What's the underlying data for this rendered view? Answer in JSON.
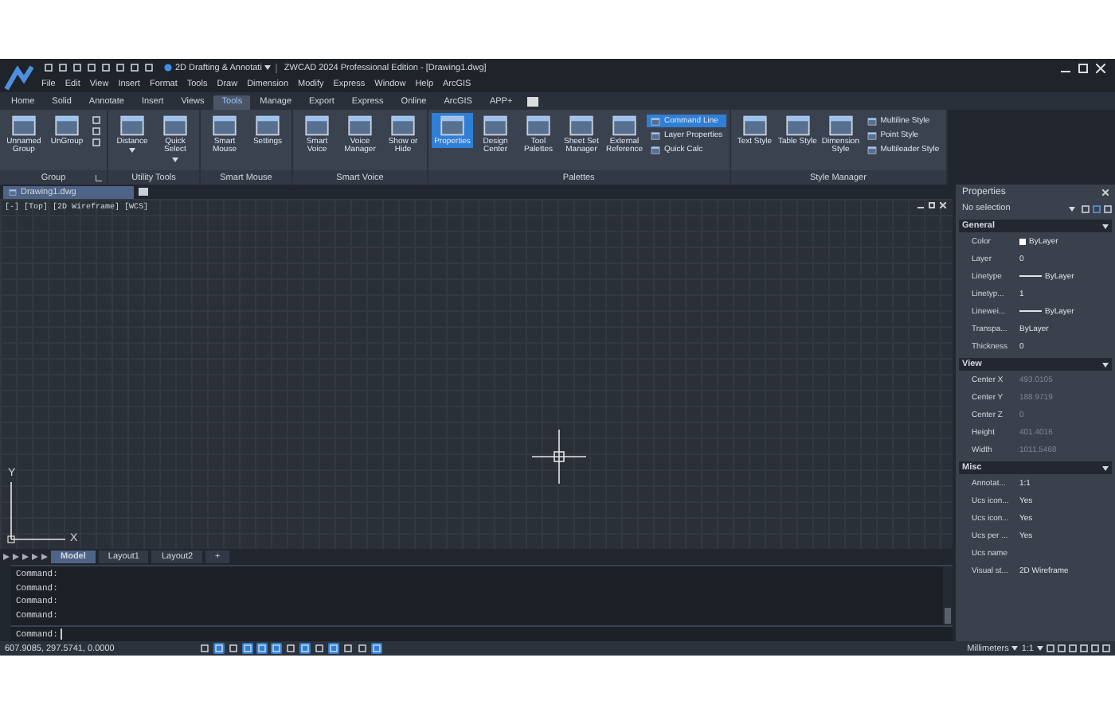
{
  "title_bar": {
    "workspace": "2D Drafting & Annotati",
    "title": "ZWCAD 2024 Professional Edition - [Drawing1.dwg]"
  },
  "menu": [
    "File",
    "Edit",
    "View",
    "Insert",
    "Format",
    "Tools",
    "Draw",
    "Dimension",
    "Modify",
    "Express",
    "Window",
    "Help",
    "ArcGIS"
  ],
  "tabs": [
    {
      "label": "Home",
      "selected": false
    },
    {
      "label": "Solid",
      "selected": false
    },
    {
      "label": "Annotate",
      "selected": false
    },
    {
      "label": "Insert",
      "selected": false
    },
    {
      "label": "Views",
      "selected": false
    },
    {
      "label": "Tools",
      "selected": true
    },
    {
      "label": "Manage",
      "selected": false
    },
    {
      "label": "Export",
      "selected": false
    },
    {
      "label": "Express",
      "selected": false
    },
    {
      "label": "Online",
      "selected": false
    },
    {
      "label": "ArcGIS",
      "selected": false
    },
    {
      "label": "APP+",
      "selected": false
    }
  ],
  "ribbon": {
    "panels": [
      {
        "label": "Group",
        "launcher": true,
        "items": [
          {
            "kind": "large",
            "label": "Unnamed Group",
            "selected": false,
            "dropdown": false
          },
          {
            "kind": "large",
            "label": "UnGroup",
            "selected": false,
            "dropdown": false
          },
          {
            "kind": "icons"
          }
        ]
      },
      {
        "label": "Utility Tools",
        "launcher": false,
        "items": [
          {
            "kind": "large",
            "label": "Distance",
            "selected": false,
            "dropdown": true
          },
          {
            "kind": "large",
            "label": "Quick Select",
            "selected": false,
            "dropdown": true
          }
        ]
      },
      {
        "label": "Smart Mouse",
        "launcher": false,
        "items": [
          {
            "kind": "large",
            "label": "Smart Mouse",
            "selected": false,
            "dropdown": false
          },
          {
            "kind": "large",
            "label": "Settings",
            "selected": false,
            "dropdown": false
          }
        ]
      },
      {
        "label": "Smart Voice",
        "launcher": false,
        "items": [
          {
            "kind": "large",
            "label": "Smart Voice",
            "selected": false,
            "dropdown": false
          },
          {
            "kind": "large",
            "label": "Voice Manager",
            "selected": false,
            "dropdown": false
          },
          {
            "kind": "large",
            "label": "Show or Hide",
            "selected": false,
            "dropdown": false
          }
        ]
      },
      {
        "label": "Palettes",
        "launcher": false,
        "items": [
          {
            "kind": "large",
            "label": "Properties",
            "selected": true,
            "dropdown": false
          },
          {
            "kind": "large",
            "label": "Design Center",
            "selected": false,
            "dropdown": false
          },
          {
            "kind": "large",
            "label": "Tool Palettes",
            "selected": false,
            "dropdown": false
          },
          {
            "kind": "large",
            "label": "Sheet Set Manager",
            "selected": false,
            "dropdown": false
          },
          {
            "kind": "large",
            "label": "External Reference",
            "selected": false,
            "dropdown": false
          },
          {
            "kind": "small",
            "buttons": [
              {
                "label": "Command Line",
                "selected": true
              },
              {
                "label": "Layer Properties",
                "selected": false
              },
              {
                "label": "Quick Calc",
                "selected": false
              }
            ]
          }
        ]
      },
      {
        "label": "Style Manager",
        "launcher": false,
        "items": [
          {
            "kind": "large",
            "label": "Text Style",
            "selected": false,
            "dropdown": false
          },
          {
            "kind": "large",
            "label": "Table Style",
            "selected": false,
            "dropdown": false
          },
          {
            "kind": "large",
            "label": "Dimension Style",
            "selected": false,
            "dropdown": false
          },
          {
            "kind": "small",
            "buttons": [
              {
                "label": "Multiline Style",
                "selected": false
              },
              {
                "label": "Point Style",
                "selected": false
              },
              {
                "label": "Multileader Style",
                "selected": false
              }
            ]
          }
        ]
      }
    ]
  },
  "document_tabs": [
    {
      "label": "Drawing1.dwg",
      "selected": true
    }
  ],
  "viewport": {
    "label": "[-] [Top] [2D Wireframe] [WCS]",
    "axis_x": "X",
    "axis_y": "Y"
  },
  "layout_tabs": [
    {
      "label": "Model",
      "selected": true
    },
    {
      "label": "Layout1",
      "selected": false
    },
    {
      "label": "Layout2",
      "selected": false
    }
  ],
  "new_layout": "+",
  "command": {
    "history": [
      "Command:",
      "Command:",
      "Command:",
      "Command:"
    ],
    "prompt": "Command:"
  },
  "properties": {
    "title": "Properties",
    "selection": "No selection",
    "sections": [
      {
        "title": "General",
        "rows": [
          {
            "label": "Color",
            "value": "ByLayer",
            "kind": "swatch",
            "disabled": false
          },
          {
            "label": "Layer",
            "value": "0",
            "kind": "text",
            "disabled": false
          },
          {
            "label": "Linetype",
            "value": "ByLayer",
            "kind": "line",
            "disabled": false
          },
          {
            "label": "Linetyp...",
            "value": "1",
            "kind": "text",
            "disabled": false
          },
          {
            "label": "Linewei...",
            "value": "ByLayer",
            "kind": "line",
            "disabled": false
          },
          {
            "label": "Transpa...",
            "value": "ByLayer",
            "kind": "text",
            "disabled": false
          },
          {
            "label": "Thickness",
            "value": "0",
            "kind": "text",
            "disabled": false
          }
        ]
      },
      {
        "title": "View",
        "rows": [
          {
            "label": "Center X",
            "value": "493.0105",
            "kind": "text",
            "disabled": true
          },
          {
            "label": "Center Y",
            "value": "188.9719",
            "kind": "text",
            "disabled": true
          },
          {
            "label": "Center Z",
            "value": "0",
            "kind": "text",
            "disabled": true
          },
          {
            "label": "Height",
            "value": "401.4016",
            "kind": "text",
            "disabled": true
          },
          {
            "label": "Width",
            "value": "1011.5468",
            "kind": "text",
            "disabled": true
          }
        ]
      },
      {
        "title": "Misc",
        "rows": [
          {
            "label": "Annotat...",
            "value": "1:1",
            "kind": "text",
            "disabled": false
          },
          {
            "label": "Ucs icon...",
            "value": "Yes",
            "kind": "text",
            "disabled": false
          },
          {
            "label": "Ucs icon...",
            "value": "Yes",
            "kind": "text",
            "disabled": false
          },
          {
            "label": "Ucs per ...",
            "value": "Yes",
            "kind": "text",
            "disabled": false
          },
          {
            "label": "Ucs name"
          },
          {
            "label": "Visual st...",
            "value": "2D Wireframe",
            "kind": "text",
            "disabled": false
          }
        ]
      }
    ]
  },
  "status_bar": {
    "coordinates": "607.9085, 297.5741, 0.0000",
    "toggles": [
      {
        "on": false
      },
      {
        "on": true
      },
      {
        "on": false
      },
      {
        "on": true
      },
      {
        "on": true
      },
      {
        "on": true
      },
      {
        "on": false
      },
      {
        "on": true
      },
      {
        "on": false
      },
      {
        "on": true
      },
      {
        "on": false
      },
      {
        "on": false
      },
      {
        "on": true
      }
    ],
    "units": "Millimeters",
    "scale": "1:1"
  }
}
